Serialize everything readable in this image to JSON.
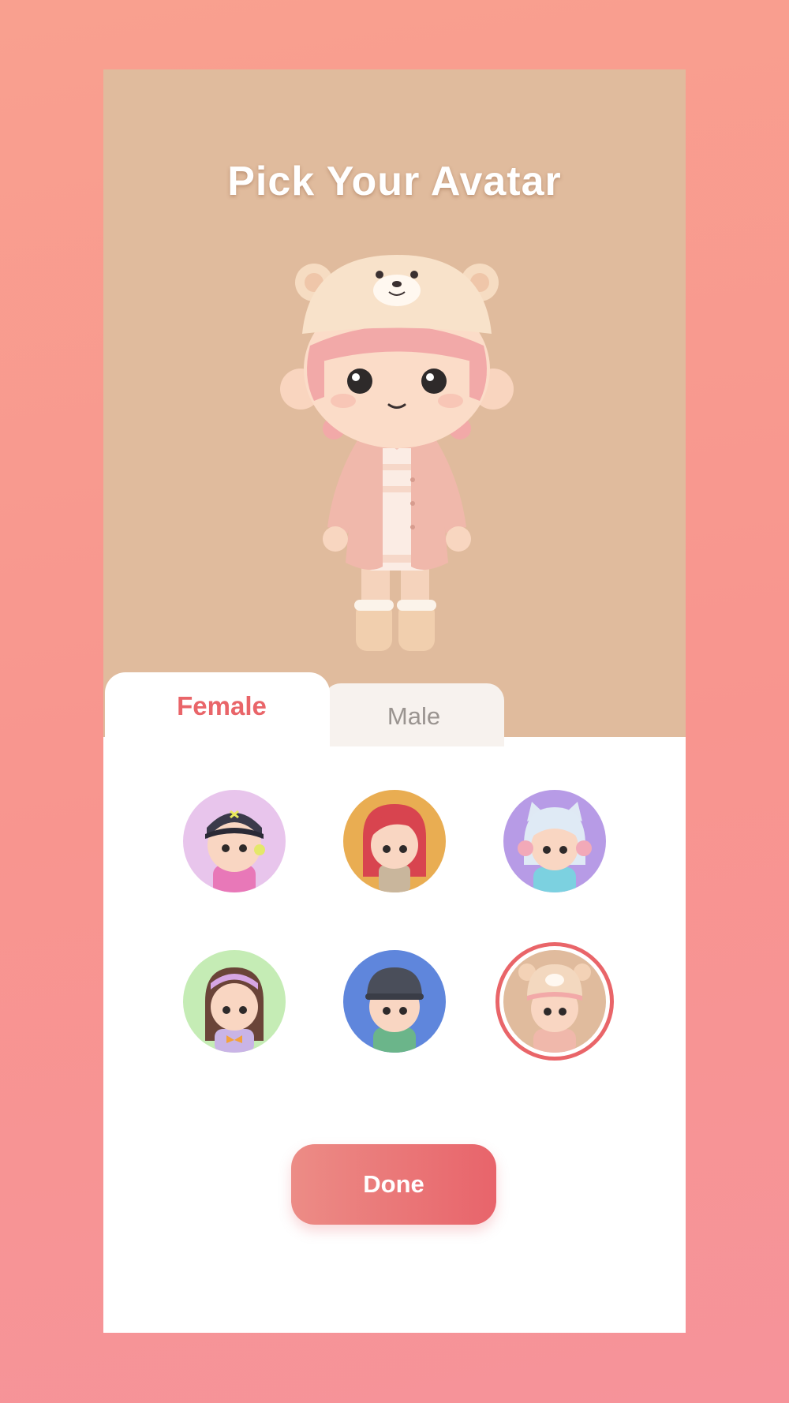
{
  "screen": {
    "title": "Pick Your Avatar"
  },
  "tabs": {
    "female_label": "Female",
    "male_label": "Male",
    "active": "Female"
  },
  "avatars": [
    {
      "icon": "avatar-girl-navy-cap",
      "bg": "#e8c5ec"
    },
    {
      "icon": "avatar-girl-red-hair",
      "bg": "#e9ad52"
    },
    {
      "icon": "avatar-girl-cat-headphones",
      "bg": "#b79be6"
    },
    {
      "icon": "avatar-girl-headband",
      "bg": "#c5ecb5"
    },
    {
      "icon": "avatar-boy-gray-cap",
      "bg": "#5f86dc"
    },
    {
      "icon": "avatar-girl-bear-hat",
      "bg": "#e0bb9d",
      "selected": true
    }
  ],
  "actions": {
    "done_label": "Done"
  },
  "colors": {
    "accent": "#e96569",
    "hero_bg": "#e0bb9d",
    "page_bg": "#f8988f"
  }
}
